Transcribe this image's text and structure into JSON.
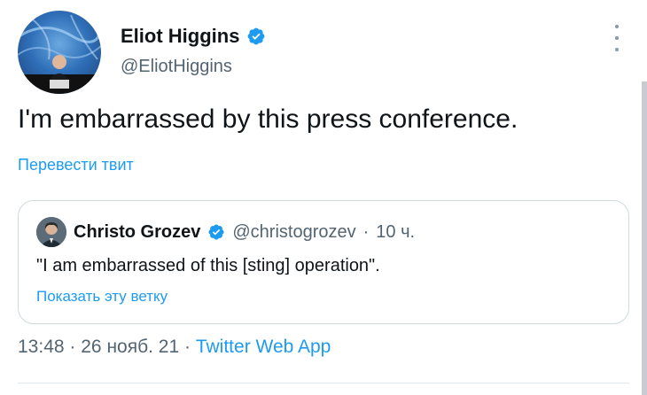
{
  "author": {
    "name": "Eliot Higgins",
    "handle": "@EliotHiggins",
    "verified_icon": "verified-badge-icon",
    "avatar_icon": "avatar"
  },
  "tweet": {
    "text": "I'm embarrassed by this press conference.",
    "translate_link": "Перевести твит"
  },
  "quoted_tweet": {
    "name": "Christo Grozev",
    "handle": "@christogrozev",
    "separator": "·",
    "time": "10 ч.",
    "text": "\"I am embarrassed of this [sting] operation\".",
    "show_thread_link": "Показать эту ветку"
  },
  "footer": {
    "time": "13:48",
    "sep1": "·",
    "date": "26 нояб. 21",
    "sep2": "·",
    "app": "Twitter Web App"
  },
  "colors": {
    "link": "#1d9bf0",
    "secondary_text": "#536471",
    "primary_text": "#0f1419",
    "border": "#cfd9de"
  }
}
